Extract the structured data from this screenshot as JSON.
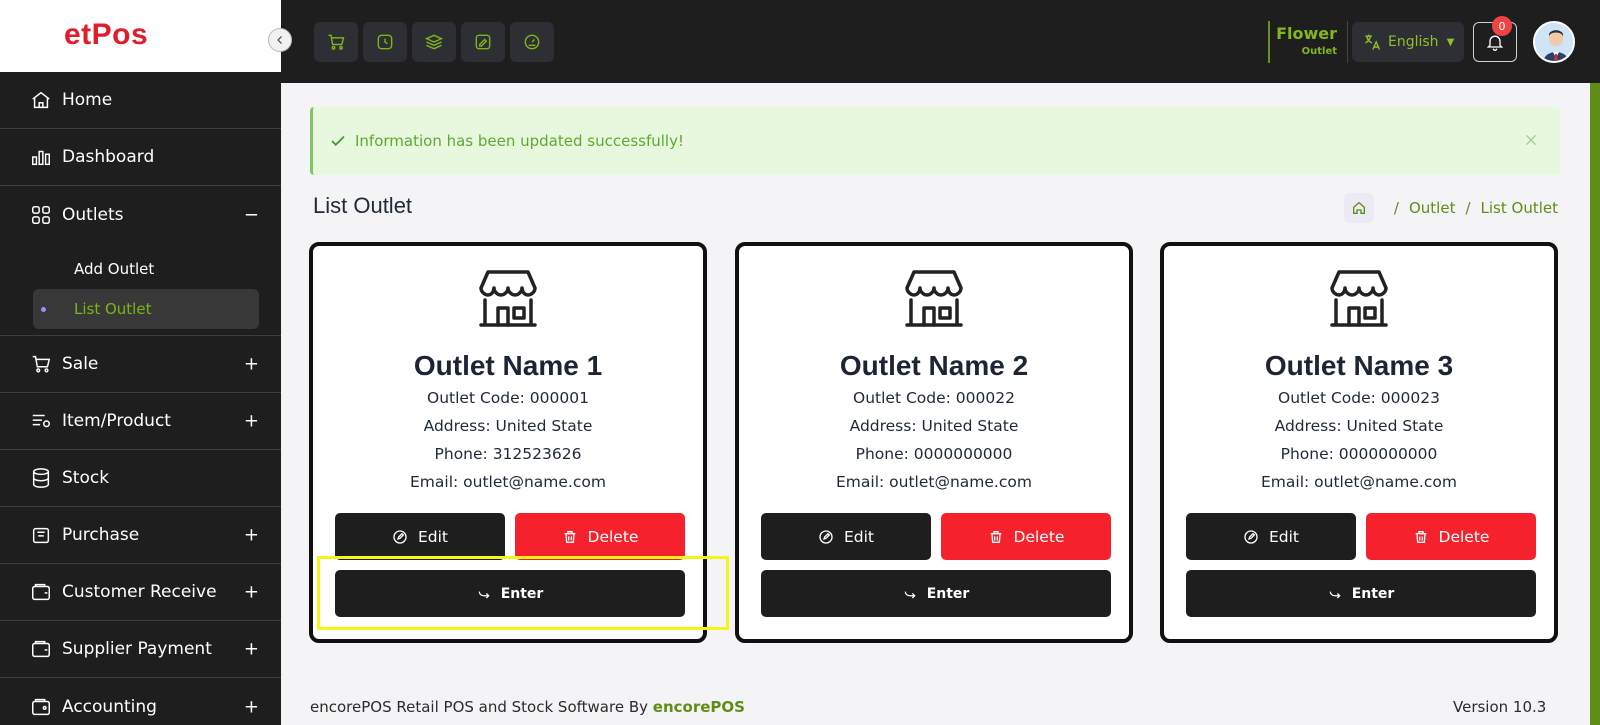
{
  "app": {
    "logo_text": "etPos"
  },
  "sidebar": {
    "items": [
      {
        "label": "Home",
        "icon": "home-icon",
        "toggle": ""
      },
      {
        "label": "Dashboard",
        "icon": "chart-icon",
        "toggle": ""
      },
      {
        "label": "Outlets",
        "icon": "grid-icon",
        "toggle": "−"
      },
      {
        "label": "Sale",
        "icon": "cart-icon",
        "toggle": "+"
      },
      {
        "label": "Item/Product",
        "icon": "list-icon",
        "toggle": "+"
      },
      {
        "label": "Stock",
        "icon": "database-icon",
        "toggle": ""
      },
      {
        "label": "Purchase",
        "icon": "basket-icon",
        "toggle": "+"
      },
      {
        "label": "Customer Receive",
        "icon": "wallet-icon",
        "toggle": "+"
      },
      {
        "label": "Supplier Payment",
        "icon": "wallet-icon",
        "toggle": "+"
      },
      {
        "label": "Accounting",
        "icon": "wallet-icon",
        "toggle": "+"
      }
    ],
    "outlets_submenu": [
      {
        "label": "Add Outlet",
        "active": false
      },
      {
        "label": "List Outlet",
        "active": true
      }
    ]
  },
  "topbar": {
    "outlet_name": "Flower",
    "outlet_sub": "Outlet",
    "language": "English",
    "notification_count": "0"
  },
  "alert": {
    "message": "Information has been updated successfully!"
  },
  "page": {
    "title": "List Outlet",
    "breadcrumb": [
      "Outlet",
      "List Outlet"
    ]
  },
  "outlets": [
    {
      "name": "Outlet Name 1",
      "code": "Outlet Code: 000001",
      "address": "Address: United State",
      "phone": "Phone: 312523626",
      "email": "Email: outlet@name.com"
    },
    {
      "name": "Outlet Name 2",
      "code": "Outlet Code: 000022",
      "address": "Address: United State",
      "phone": "Phone: 0000000000",
      "email": "Email: outlet@name.com"
    },
    {
      "name": "Outlet Name 3",
      "code": "Outlet Code: 000023",
      "address": "Address: United State",
      "phone": "Phone: 0000000000",
      "email": "Email: outlet@name.com"
    }
  ],
  "buttons": {
    "edit": "Edit",
    "delete": "Delete",
    "enter": "Enter"
  },
  "footer": {
    "text": "encorePOS Retail POS and Stock Software By ",
    "brand": "encorePOS",
    "version": "Version 10.3"
  },
  "colors": {
    "accent": "#5f8d16",
    "danger": "#f5222d",
    "dark": "#1e1e1e",
    "success_bg": "#e8f8df"
  }
}
